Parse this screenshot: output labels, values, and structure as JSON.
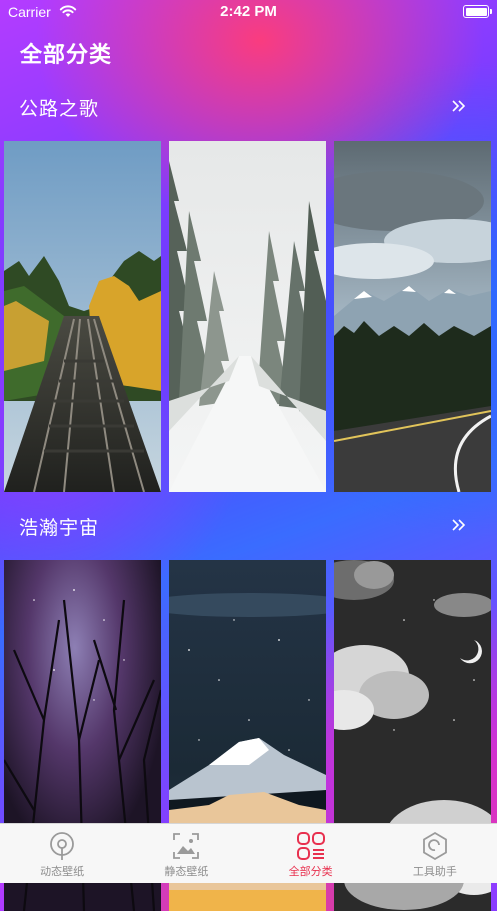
{
  "status_bar": {
    "carrier": "Carrier",
    "time": "2:42 PM"
  },
  "page_title": "全部分类",
  "sections": [
    {
      "title": "公路之歌",
      "wallpapers": [
        "railway-forest",
        "snowy-forest-road",
        "mountain-highway"
      ]
    },
    {
      "title": "浩瀚宇宙",
      "wallpapers": [
        "starry-trees",
        "night-mountain",
        "moon-clouds"
      ]
    }
  ],
  "tabs": [
    {
      "label": "动态壁纸",
      "icon": "live-wallpaper-icon",
      "active": false
    },
    {
      "label": "静态壁纸",
      "icon": "image-icon",
      "active": false
    },
    {
      "label": "全部分类",
      "icon": "category-grid-icon",
      "active": true
    },
    {
      "label": "工具助手",
      "icon": "tools-icon",
      "active": false
    }
  ],
  "colors": {
    "active_tab": "#e8314f",
    "inactive_tab": "#8e8e8e",
    "tabbar_bg": "#f7f7f7"
  }
}
